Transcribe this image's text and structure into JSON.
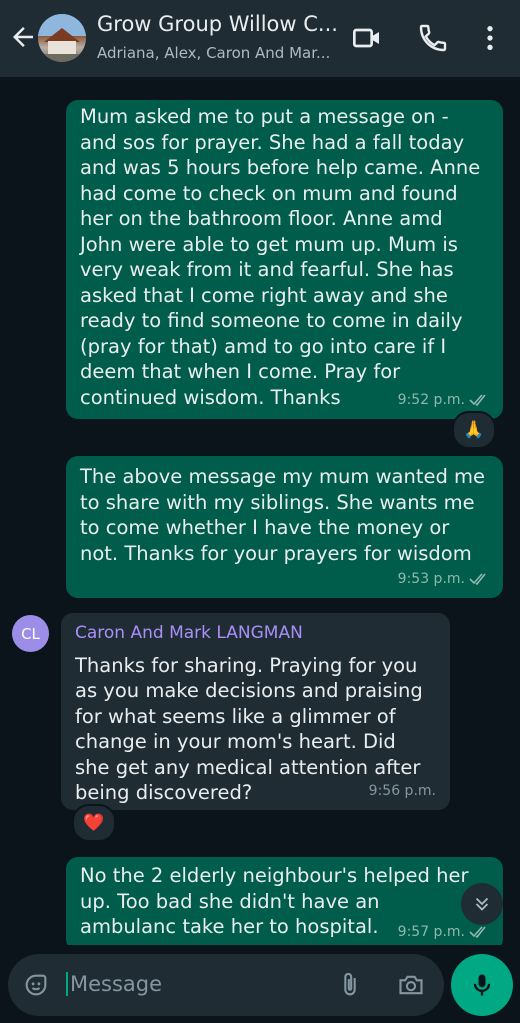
{
  "header": {
    "title": "Grow Group Willow C...",
    "subtitle": "Adriana, Alex, Caron And Mar..."
  },
  "messages": [
    {
      "text": "Mum asked me to put a message on - and sos for prayer.  She had a fall today and was 5 hours before help came.  Anne had come to check on mum and found her on the bathroom floor.  Anne amd John were able to get mum up.  Mum is very weak from it and fearful.  She has asked that I come right away and she ready to find someone to come in daily (pray for that) amd to go into care if I deem that when I come.  Pray for continued wisdom.  Thanks",
      "time": "9:52 p.m.",
      "reaction": "🙏"
    },
    {
      "text": "The above message my mum wanted me to share with my siblings.  She wants me to come whether I have the money or not.  Thanks for your prayers for wisdom",
      "time": "9:53 p.m."
    },
    {
      "sender": "Caron And Mark LANGMAN",
      "initials": "CL",
      "text": "Thanks for sharing.  Praying for you as you make decisions and praising for what seems like a glimmer of change in your mom's heart.   Did she get any medical attention after being discovered?",
      "time": "9:56 p.m.",
      "reaction": "❤️"
    },
    {
      "text": "No the 2 elderly neighbour's helped her up.  Too bad she didn't have an ambulanc take her to hospital.",
      "time": "9:57 p.m."
    }
  ],
  "composer": {
    "placeholder": "Message"
  },
  "colors": {
    "outgoing_bubble": "#005c4b",
    "incoming_bubble": "#1f2c34",
    "accent": "#00a884",
    "sender_name": "#a990f8"
  }
}
